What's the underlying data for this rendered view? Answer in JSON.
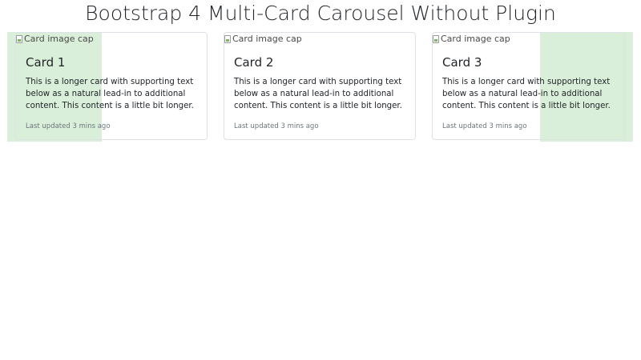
{
  "page": {
    "title": "Bootstrap 4 Multi-Card Carousel Without Plugin"
  },
  "carousel": {
    "cards": [
      {
        "image_alt": "Card image cap",
        "title": "Card 1",
        "text": "This is a longer card with supporting text below as a natural lead-in to additional content. This content is a little bit longer.",
        "updated": "Last updated 3 mins ago"
      },
      {
        "image_alt": "Card image cap",
        "title": "Card 2",
        "text": "This is a longer card with supporting text below as a natural lead-in to additional content. This content is a little bit longer.",
        "updated": "Last updated 3 mins ago"
      },
      {
        "image_alt": "Card image cap",
        "title": "Card 3",
        "text": "This is a longer card with supporting text below as a natural lead-in to additional content. This content is a little bit longer.",
        "updated": "Last updated 3 mins ago"
      }
    ]
  },
  "colors": {
    "nav_overlay": "#d6edd5",
    "card_border": "#dee2e6",
    "muted_text": "#6c757d"
  }
}
